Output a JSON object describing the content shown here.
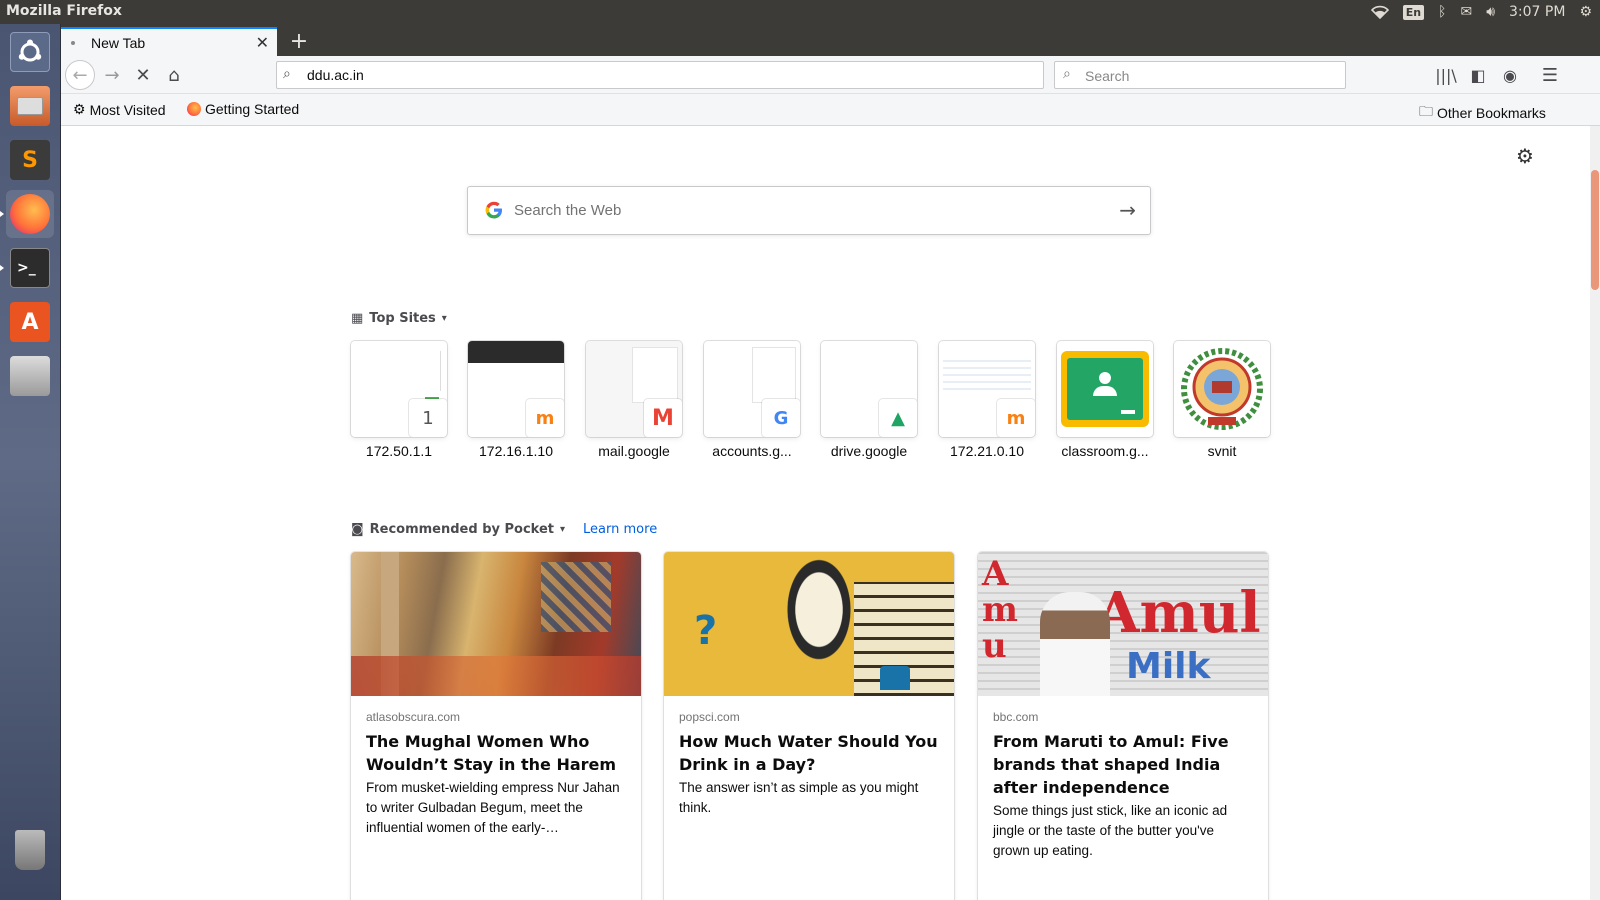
{
  "panel": {
    "app_title": "Mozilla Firefox",
    "lang": "En",
    "clock": "3:07 PM"
  },
  "tab": {
    "title": "New Tab"
  },
  "nav": {
    "url": "ddu.ac.in",
    "search_placeholder": "Search"
  },
  "bookmarks": {
    "most_visited": "Most Visited",
    "getting_started": "Getting Started",
    "other": "Other Bookmarks"
  },
  "newtab": {
    "websearch_placeholder": "Search the Web",
    "top_sites_title": "Top Sites",
    "top_sites": [
      {
        "label": "172.50.1.1",
        "badge": "1"
      },
      {
        "label": "172.16.1.10",
        "badge": "m"
      },
      {
        "label": "mail.google",
        "badge": "M"
      },
      {
        "label": "accounts.g...",
        "badge": "G"
      },
      {
        "label": "drive.google",
        "badge": "▲"
      },
      {
        "label": "172.21.0.10",
        "badge": "m"
      },
      {
        "label": "classroom.g...",
        "badge": ""
      },
      {
        "label": "svnit",
        "badge": ""
      }
    ],
    "pocket_title": "Recommended by Pocket",
    "learn_more": "Learn more",
    "stories": [
      {
        "source": "atlasobscura.com",
        "headline": "The Mughal Women Who Wouldn’t Stay in the Harem",
        "excerpt": "From musket-wielding empress Nur Jahan to writer Gulbadan Begum, meet the influential women of the early-…"
      },
      {
        "source": "popsci.com",
        "headline": "How Much Water Should You Drink in a Day?",
        "excerpt": "The answer isn’t as simple as you might think."
      },
      {
        "source": "bbc.com",
        "headline": "From Maruti to Amul: Five brands that shaped India after independence",
        "excerpt": "Some things just stick, like an iconic ad jingle or the taste of the butter you've grown up eating."
      }
    ],
    "amul_text": "Amul",
    "amul_milk": "Milk"
  }
}
